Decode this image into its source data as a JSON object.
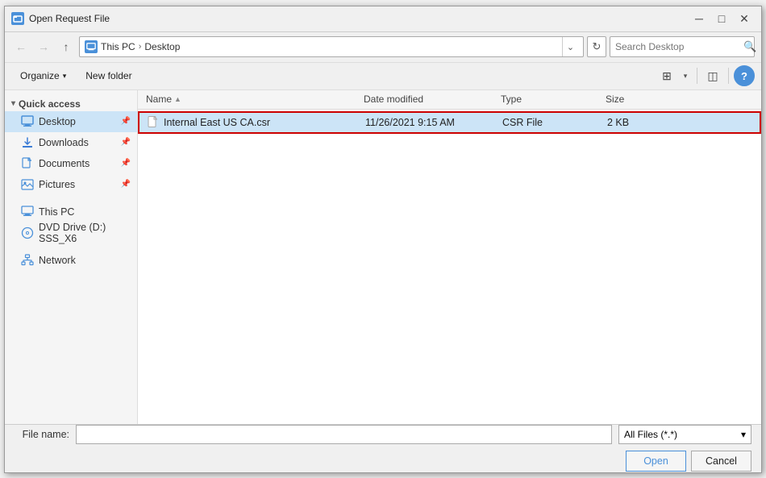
{
  "dialog": {
    "title": "Open Request File",
    "close_btn": "✕",
    "minimize_btn": "─",
    "maximize_btn": "□"
  },
  "nav": {
    "back_tooltip": "Back",
    "forward_tooltip": "Forward",
    "up_tooltip": "Up",
    "breadcrumb_icon": "💻",
    "breadcrumb_pc": "This PC",
    "breadcrumb_sep": "›",
    "breadcrumb_location": "Desktop",
    "dropdown_arrow": "⌄",
    "refresh": "↻",
    "search_placeholder": "Search Desktop",
    "search_icon": "🔍"
  },
  "toolbar": {
    "organize_label": "Organize",
    "organize_arrow": "▾",
    "new_folder_label": "New folder",
    "view_icon": "⊞",
    "view_arrow": "▾",
    "pane_icon": "▯",
    "help_label": "?"
  },
  "sidebar": {
    "quick_access_label": "Quick access",
    "items": [
      {
        "id": "desktop",
        "label": "Desktop",
        "icon": "desktop",
        "active": true,
        "pinned": true
      },
      {
        "id": "downloads",
        "label": "Downloads",
        "icon": "download",
        "active": false,
        "pinned": true
      },
      {
        "id": "documents",
        "label": "Documents",
        "icon": "docs",
        "active": false,
        "pinned": true
      },
      {
        "id": "pictures",
        "label": "Pictures",
        "icon": "pics",
        "active": false,
        "pinned": true
      }
    ],
    "this_pc_label": "This PC",
    "dvd_label": "DVD Drive (D:) SSS_X6",
    "network_label": "Network"
  },
  "columns": {
    "name": "Name",
    "sort_icon": "▲",
    "date_modified": "Date modified",
    "type": "Type",
    "size": "Size"
  },
  "files": [
    {
      "name": "Internal East US CA.csr",
      "date": "11/26/2021 9:15 AM",
      "type": "CSR File",
      "size": "2 KB",
      "selected": true
    }
  ],
  "bottom": {
    "filename_label": "File name:",
    "filename_value": "",
    "filetype_label": "All Files (*.*)",
    "filetype_arrow": "▾",
    "open_label": "Open",
    "cancel_label": "Cancel"
  }
}
